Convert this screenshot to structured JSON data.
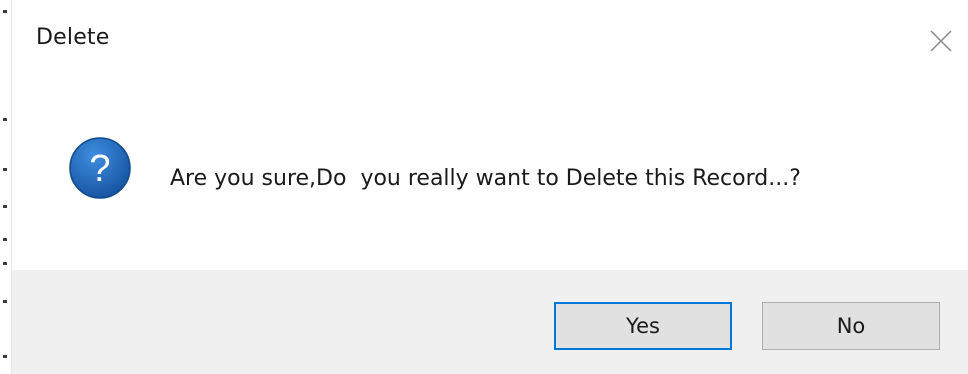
{
  "dialog": {
    "title": "Delete",
    "message": "Are you sure,Do  you really want to Delete this Record...?",
    "icon": "question-icon",
    "buttons": {
      "yes_label": "Yes",
      "no_label": "No"
    }
  },
  "colors": {
    "icon_blue": "#1a5fb4",
    "default_button_border": "#0078d7",
    "footer_bg": "#f0f0f0",
    "button_bg": "#e1e1e1"
  }
}
